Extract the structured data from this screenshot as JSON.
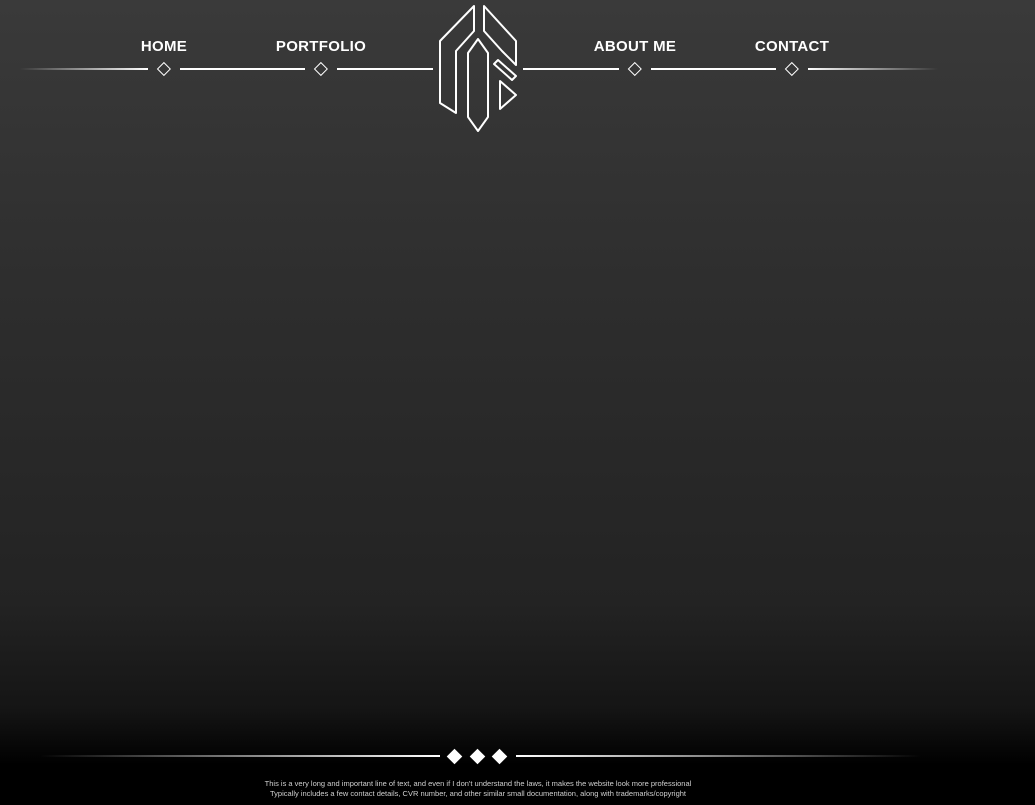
{
  "nav": {
    "items": [
      {
        "label": "HOME"
      },
      {
        "label": "PORTFOLIO"
      },
      {
        "label": "ABOUT ME"
      },
      {
        "label": "CONTACT"
      }
    ],
    "logo_icon": "geometric-monogram-logo"
  },
  "footer": {
    "line1": "This is a very long and important line of text, and even if I don't understand the laws, it makes the website look more professional",
    "line2": "Typically includes a few contact details, CVR number, and other similar small documentation, along with trademarks/copyright",
    "ornament_icon": "three-diamonds-icon"
  },
  "colors": {
    "background_top": "#3a3a3a",
    "background_bottom": "#000000",
    "foreground": "#ffffff"
  }
}
